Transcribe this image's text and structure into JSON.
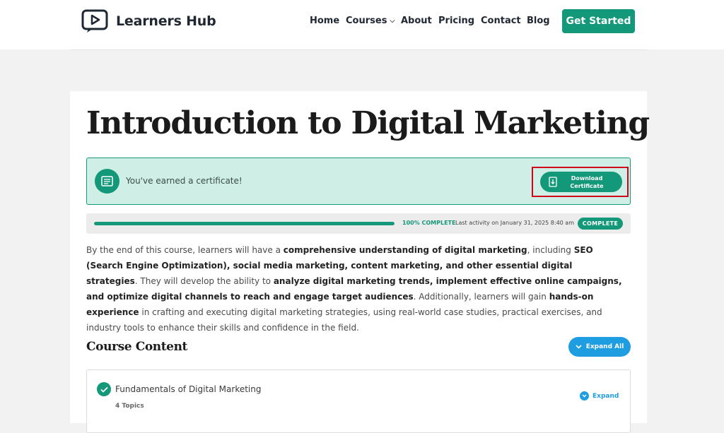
{
  "header": {
    "logo_text": "Learners Hub",
    "nav": [
      {
        "label": "Home"
      },
      {
        "label": "Courses",
        "has_dropdown": true
      },
      {
        "label": "About"
      },
      {
        "label": "Pricing"
      },
      {
        "label": "Contact"
      },
      {
        "label": "Blog"
      }
    ],
    "cta_label": "Get Started"
  },
  "course": {
    "title": "Introduction to Digital Marketing",
    "certificate": {
      "message": "You've earned a certificate!",
      "button_label": "Download\nCertificate"
    },
    "progress": {
      "percent": 100,
      "percent_label": "100% COMPLETE",
      "activity": "Last activity on January 31, 2025 8:40 am",
      "status": "COMPLETE"
    },
    "description": [
      {
        "text": "By the end of this course, learners will have a ",
        "bold": false
      },
      {
        "text": "comprehensive understanding of digital marketing",
        "bold": true
      },
      {
        "text": ", including ",
        "bold": false
      },
      {
        "text": "SEO (Search Engine Optimization), social media marketing, content marketing, and other essential digital strategies",
        "bold": true
      },
      {
        "text": ". They will develop the ability to ",
        "bold": false
      },
      {
        "text": "analyze digital marketing trends, implement effective online campaigns, and optimize digital channels to reach and engage target audiences",
        "bold": true
      },
      {
        "text": ". Additionally, learners will gain ",
        "bold": false
      },
      {
        "text": "hands-on experience",
        "bold": true
      },
      {
        "text": " in crafting and executing digital marketing strategies, using real-world case studies, practical exercises, and industry tools to enhance their skills and confidence in the field.",
        "bold": false
      }
    ],
    "content_section": {
      "title": "Course Content",
      "expand_all_label": "Expand All",
      "lessons": [
        {
          "title": "Fundamentals of Digital Marketing",
          "topics": "4 Topics",
          "expand_label": "Expand"
        }
      ]
    }
  },
  "colors": {
    "accent": "#14987a",
    "accent_light": "#cfeee6",
    "blue": "#1e9de0",
    "highlight": "#d0021b",
    "page_bg": "#f2f2f2"
  },
  "icons": {
    "logo": "video-play-icon",
    "certificate": "certificate-icon",
    "download": "download-icon",
    "check": "check-circle-icon",
    "chevron": "chevron-down-icon"
  }
}
